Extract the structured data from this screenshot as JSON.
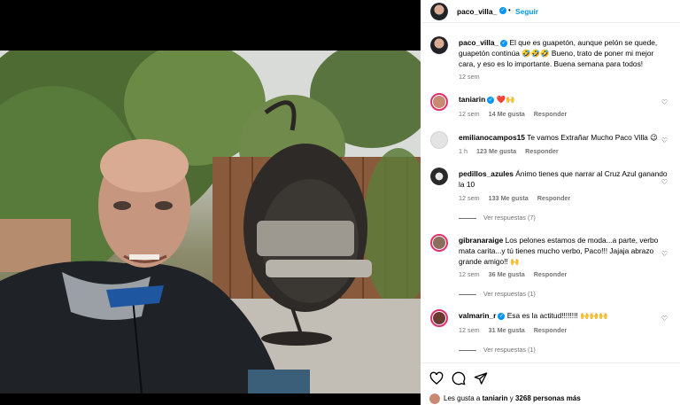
{
  "post": {
    "author": "paco_villa_",
    "follow_label": "Seguir",
    "separator": "•",
    "caption": "El que es guapetón, aunque pelón se quede, guapetón continúa 🤣🤣🤣 Bueno, trato de poner mi mejor cara, y eso es lo importante. Buena semana para todos!",
    "caption_time": "12 sem"
  },
  "comments": [
    {
      "user": "taniarin",
      "verified": true,
      "text": "❤️🙌",
      "time": "12 sem",
      "likes": "14 Me gusta",
      "reply": "Responder",
      "view_replies": ""
    },
    {
      "user": "emilianocampos15",
      "verified": false,
      "text": "Te vamos Extrañar Mucho Paco Villa 😉",
      "time": "1 h",
      "likes": "123 Me gusta",
      "reply": "Responder",
      "view_replies": ""
    },
    {
      "user": "pedillos_azules",
      "verified": false,
      "text": "Ánimo tienes que narrar al Cruz Azul ganando la 10",
      "time": "12 sem",
      "likes": "133 Me gusta",
      "reply": "Responder",
      "view_replies": "Ver respuestas (7)"
    },
    {
      "user": "gibranaraige",
      "verified": false,
      "text": "Los pelones estamos de moda...a parte, verbo mata carita...y tú tienes mucho verbo, Paco!!! Jajaja abrazo grande amigo!! 🙌",
      "time": "12 sem",
      "likes": "36 Me gusta",
      "reply": "Responder",
      "view_replies": "Ver respuestas (1)"
    },
    {
      "user": "valmarin_r",
      "verified": true,
      "text": "Esa es la actitud!!!!!!!! 🙌🙌🙌",
      "time": "12 sem",
      "likes": "31 Me gusta",
      "reply": "Responder",
      "view_replies": "Ver respuestas (1)"
    }
  ],
  "actions": {
    "like_icon": "heart-outline-icon",
    "comment_icon": "comment-bubble-icon",
    "share_icon": "paper-plane-icon",
    "likes_prefix": "Les gusta a",
    "likes_user": "taniarin",
    "likes_joiner": "y",
    "likes_count": "3268 personas más"
  },
  "colors": {
    "accent": "#0095f6",
    "story_ring": "#e1306c",
    "muted": "#737373"
  }
}
